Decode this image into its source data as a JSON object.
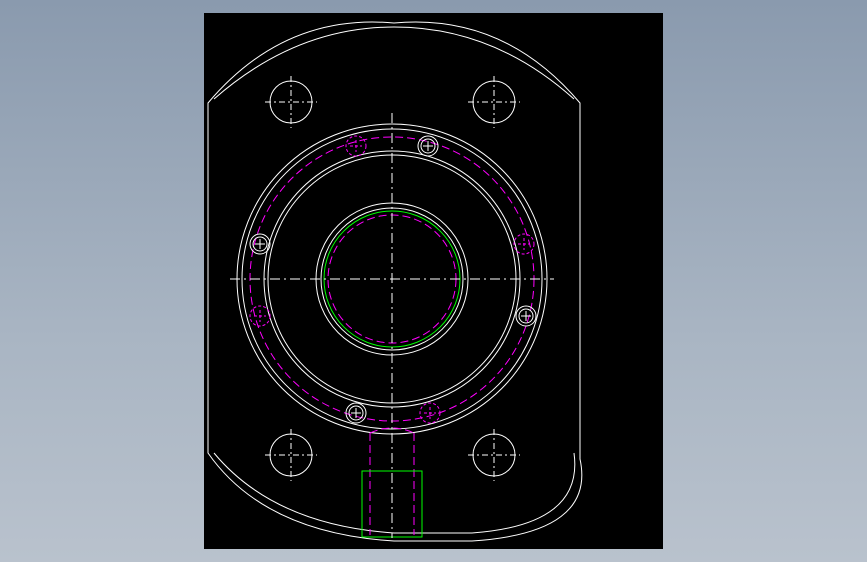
{
  "colors": {
    "background_gradient_top": "#8a9aae",
    "background_gradient_bottom": "#b9c2cd",
    "viewport": "#000000",
    "outline": "#ffffff",
    "hidden_line": "#ff00ff",
    "thread_line": "#00ff00"
  },
  "drawing": {
    "view": "front",
    "bolt_holes_corner": 4,
    "screws_on_flange": 4,
    "hidden_screw_holes": 4,
    "has_center_lines": true,
    "has_bottom_port": true
  }
}
